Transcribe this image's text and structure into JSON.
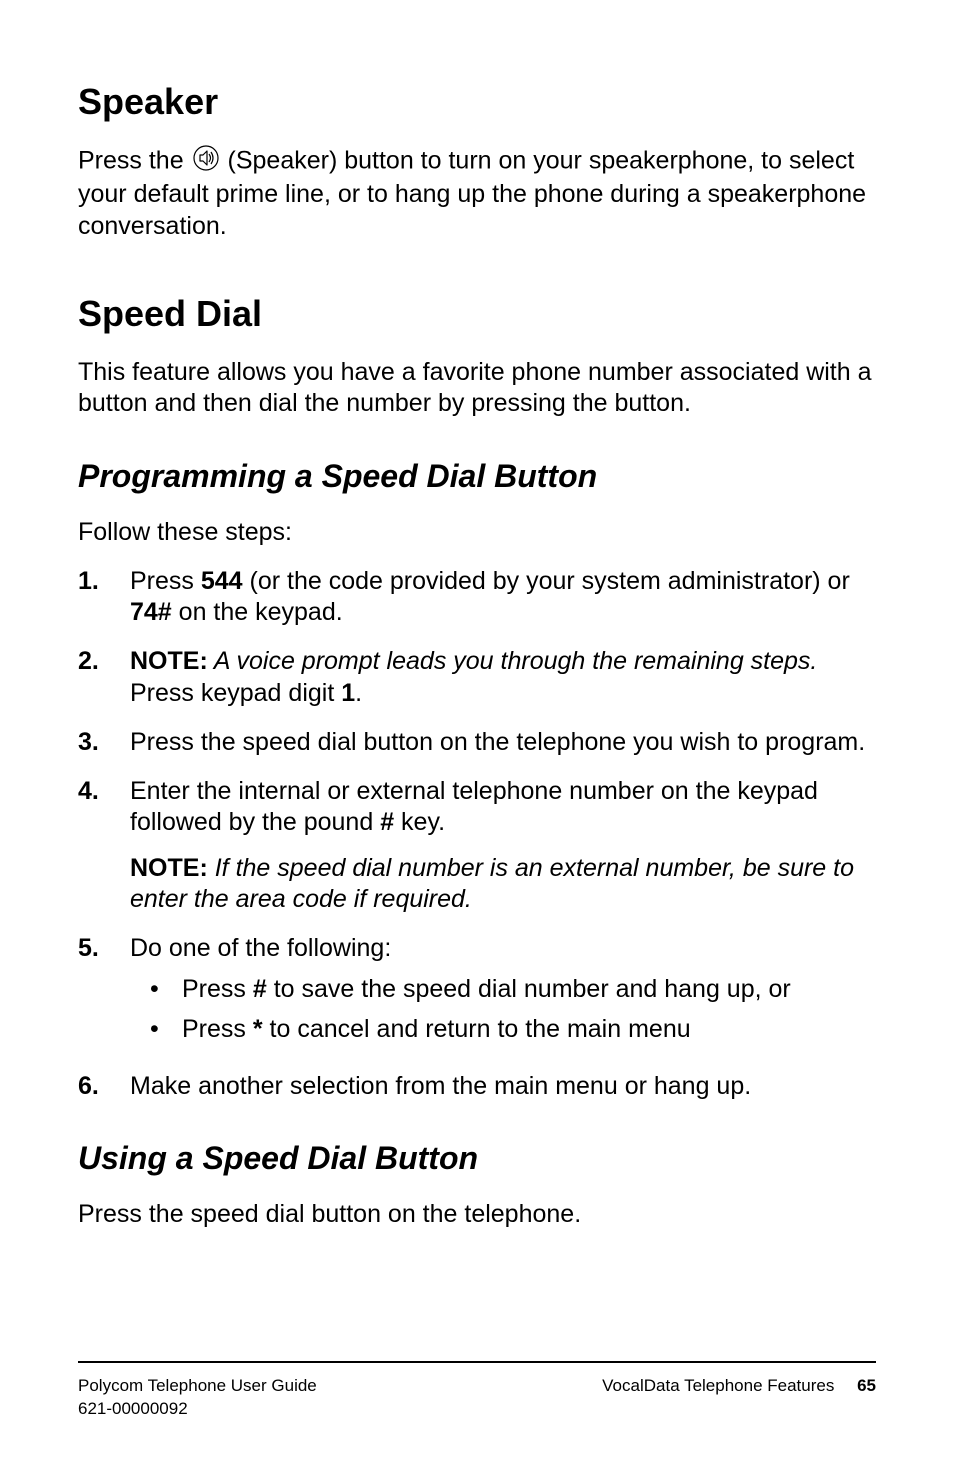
{
  "section_speaker": {
    "heading": "Speaker",
    "para_prefix": "Press the ",
    "icon_name": "speaker-icon",
    "para_suffix": " (Speaker) button to turn on your speakerphone, to select your default prime line, or to hang up the phone during a speakerphone conversation."
  },
  "section_speed_dial": {
    "heading": "Speed Dial",
    "intro": "This feature allows you have a favorite phone number associated with a button and then dial the number by pressing the button.",
    "programming": {
      "heading": "Programming a Speed Dial Button",
      "lead": "Follow these steps:",
      "steps": [
        {
          "num": "1.",
          "runs": [
            {
              "t": "Press "
            },
            {
              "t": "544",
              "b": true
            },
            {
              "t": " (or the code provided by your system administrator) or "
            },
            {
              "t": "74#",
              "b": true
            },
            {
              "t": " on the keypad."
            }
          ]
        },
        {
          "num": "2.",
          "runs": [
            {
              "t": "NOTE:",
              "b": true
            },
            {
              "t": " A voice prompt leads you through the remaining steps.",
              "i": true
            },
            {
              "t": " Press keypad digit "
            },
            {
              "t": "1",
              "b": true
            },
            {
              "t": "."
            }
          ]
        },
        {
          "num": "3.",
          "runs": [
            {
              "t": "Press the speed dial button on the telephone you wish to program."
            }
          ]
        },
        {
          "num": "4.",
          "runs": [
            {
              "t": "Enter the internal or external telephone number on the keypad followed by the pound "
            },
            {
              "t": "#",
              "b": true
            },
            {
              "t": " key."
            }
          ],
          "note_runs": [
            {
              "t": "NOTE:",
              "b": true
            },
            {
              "t": " If the speed dial number is an external number, be sure to enter the area code if required.",
              "i": true
            }
          ]
        },
        {
          "num": "5.",
          "runs": [
            {
              "t": "Do one of the following:"
            }
          ],
          "bullets": [
            [
              {
                "t": "Press "
              },
              {
                "t": "#",
                "b": true
              },
              {
                "t": " to save the speed dial number and hang up, or"
              }
            ],
            [
              {
                "t": "Press "
              },
              {
                "t": "*",
                "b": true
              },
              {
                "t": " to cancel and return to the main menu"
              }
            ]
          ]
        },
        {
          "num": "6.",
          "runs": [
            {
              "t": "Make another selection from the main menu or hang up."
            }
          ]
        }
      ]
    },
    "using": {
      "heading": "Using a Speed Dial Button",
      "body": "Press the speed dial button on the telephone."
    }
  },
  "footer": {
    "left_line1": "Polycom Telephone User Guide",
    "left_line2": "621-00000092",
    "right_label": "VocalData Telephone Features",
    "page": "65"
  }
}
